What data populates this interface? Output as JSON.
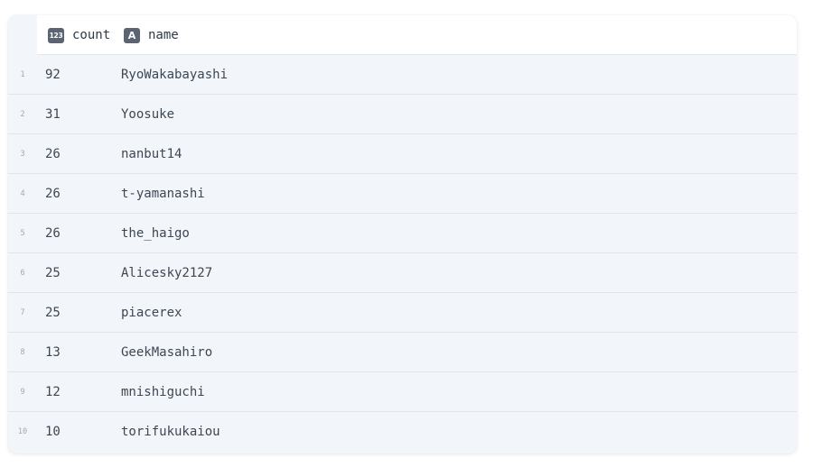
{
  "table": {
    "columns": [
      {
        "icon": "number-type-icon",
        "icon_text": "123",
        "label": "count"
      },
      {
        "icon": "text-type-icon",
        "icon_text": "A",
        "label": "name"
      }
    ],
    "rows": [
      {
        "index": "1",
        "count": "92",
        "name": "RyoWakabayashi"
      },
      {
        "index": "2",
        "count": "31",
        "name": "Yoosuke"
      },
      {
        "index": "3",
        "count": "26",
        "name": "nanbut14"
      },
      {
        "index": "4",
        "count": "26",
        "name": "t-yamanashi"
      },
      {
        "index": "5",
        "count": "26",
        "name": "the_haigo"
      },
      {
        "index": "6",
        "count": "25",
        "name": "Alicesky2127"
      },
      {
        "index": "7",
        "count": "25",
        "name": "piacerex"
      },
      {
        "index": "8",
        "count": "13",
        "name": "GeekMasahiro"
      },
      {
        "index": "9",
        "count": "12",
        "name": "mnishiguchi"
      },
      {
        "index": "10",
        "count": "10",
        "name": "torifukukaiou"
      }
    ]
  }
}
